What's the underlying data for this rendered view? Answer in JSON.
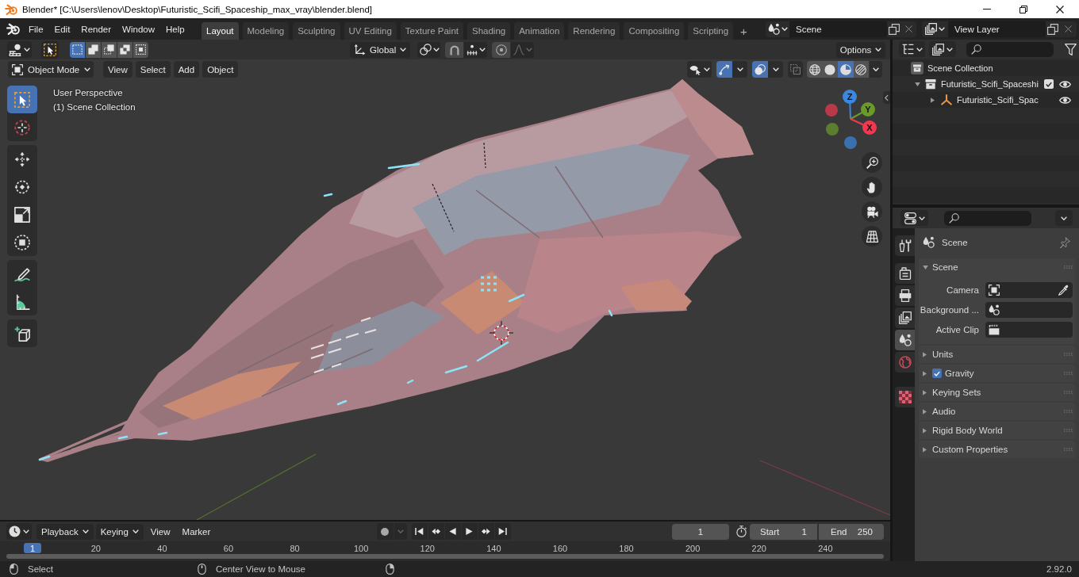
{
  "window": {
    "title": "Blender* [C:\\Users\\lenov\\Desktop\\Futuristic_Scifi_Spaceship_max_vray\\blender.blend]"
  },
  "top_bar": {
    "menus": [
      "File",
      "Edit",
      "Render",
      "Window",
      "Help"
    ],
    "workspace_tabs": [
      {
        "label": "Layout",
        "selected": true
      },
      {
        "label": "Modeling",
        "selected": false
      },
      {
        "label": "Sculpting",
        "selected": false
      },
      {
        "label": "UV Editing",
        "selected": false
      },
      {
        "label": "Texture Paint",
        "selected": false
      },
      {
        "label": "Shading",
        "selected": false
      },
      {
        "label": "Animation",
        "selected": false
      },
      {
        "label": "Rendering",
        "selected": false
      },
      {
        "label": "Compositing",
        "selected": false
      },
      {
        "label": "Scripting",
        "selected": false
      }
    ],
    "add_workspace": "+",
    "scene": "Scene",
    "view_layer": "View Layer"
  },
  "tool_header": {
    "select_modes": [
      {
        "kind": "set",
        "selected": true
      },
      {
        "kind": "extend",
        "selected": false
      },
      {
        "kind": "subtract",
        "selected": false
      },
      {
        "kind": "difference",
        "selected": false
      },
      {
        "kind": "intersect",
        "selected": false
      }
    ],
    "orientation": "Global",
    "options": "Options"
  },
  "viewport": {
    "mode": "Object Mode",
    "menus": [
      "View",
      "Select",
      "Add",
      "Object"
    ],
    "show_gizmos": true,
    "show_overlays": true,
    "xray": false,
    "shading": [
      {
        "kind": "wireframe",
        "selected": false
      },
      {
        "kind": "solid",
        "selected": false
      },
      {
        "kind": "material",
        "selected": true
      },
      {
        "kind": "rendered",
        "selected": false
      }
    ],
    "tool_groups": [
      {
        "tools": [
          {
            "kind": "select_box",
            "selected": true
          },
          {
            "kind": "cursor",
            "selected": false
          }
        ]
      },
      {
        "tools": [
          {
            "kind": "move",
            "selected": false
          },
          {
            "kind": "rotate",
            "selected": false
          },
          {
            "kind": "scale",
            "selected": false
          },
          {
            "kind": "transform",
            "selected": false
          }
        ]
      },
      {
        "tools": [
          {
            "kind": "annotate",
            "selected": false
          },
          {
            "kind": "measure",
            "selected": false
          }
        ]
      },
      {
        "tools": [
          {
            "kind": "add_cube",
            "selected": false
          }
        ]
      }
    ],
    "info": [
      "User Perspective",
      "(1) Scene Collection"
    ],
    "axes": [
      {
        "label": "Z",
        "color": "#3a87e0"
      },
      {
        "label": "Y",
        "color": "#6a9a2a"
      },
      {
        "label": "X",
        "color": "#f23850"
      }
    ]
  },
  "outliner": {
    "root": "Scene Collection",
    "items": [
      {
        "label": "Futuristic_Scifi_Spaceshi",
        "kind": "collection",
        "expanded": true,
        "checked": true,
        "visible": true,
        "children": [
          {
            "label": "Futuristic_Scifi_Spac",
            "kind": "empty",
            "expanded": false,
            "visible": true
          }
        ]
      }
    ]
  },
  "properties": {
    "tab_groups": [
      {
        "tabs": [
          {
            "kind": "tool",
            "selected": false
          }
        ]
      },
      {
        "tabs": [
          {
            "kind": "render",
            "selected": false
          },
          {
            "kind": "output",
            "selected": false
          },
          {
            "kind": "view_layer",
            "selected": false
          },
          {
            "kind": "scene",
            "selected": true
          },
          {
            "kind": "world",
            "selected": false
          }
        ]
      },
      {
        "tabs": [
          {
            "kind": "texture",
            "selected": false
          }
        ]
      }
    ],
    "context": "Scene",
    "panels": [
      {
        "label": "Scene",
        "kind": "plain",
        "expanded": true,
        "fields": [
          {
            "label": "Camera",
            "kind": "object"
          },
          {
            "label": "Background ...",
            "kind": "scene"
          },
          {
            "label": "Active Clip",
            "kind": "clip"
          }
        ]
      },
      {
        "label": "Units",
        "kind": "plain",
        "expanded": false
      },
      {
        "label": "Gravity",
        "kind": "toggle",
        "checked": true,
        "expanded": false
      },
      {
        "label": "Keying Sets",
        "kind": "plain",
        "expanded": false
      },
      {
        "label": "Audio",
        "kind": "plain",
        "expanded": false
      },
      {
        "label": "Rigid Body World",
        "kind": "plain",
        "expanded": false
      },
      {
        "label": "Custom Properties",
        "kind": "plain",
        "expanded": false
      }
    ]
  },
  "timeline": {
    "menus": [
      {
        "label": "Playback",
        "dropdown": true
      },
      {
        "label": "Keying",
        "dropdown": true
      },
      {
        "label": "View",
        "dropdown": false
      },
      {
        "label": "Marker",
        "dropdown": false
      }
    ],
    "current_frame": "1",
    "range": [
      {
        "label": "Start",
        "value": "1"
      },
      {
        "label": "End",
        "value": "250"
      }
    ],
    "playhead": "1",
    "ruler": [
      "20",
      "40",
      "60",
      "80",
      "100",
      "120",
      "140",
      "160",
      "180",
      "200",
      "220",
      "240"
    ]
  },
  "status_bar": {
    "hints": [
      {
        "kind": "left",
        "label": "Select"
      },
      {
        "kind": "middle",
        "label": "Center View to Mouse"
      },
      {
        "kind": "right"
      }
    ],
    "version": "2.92.0"
  }
}
